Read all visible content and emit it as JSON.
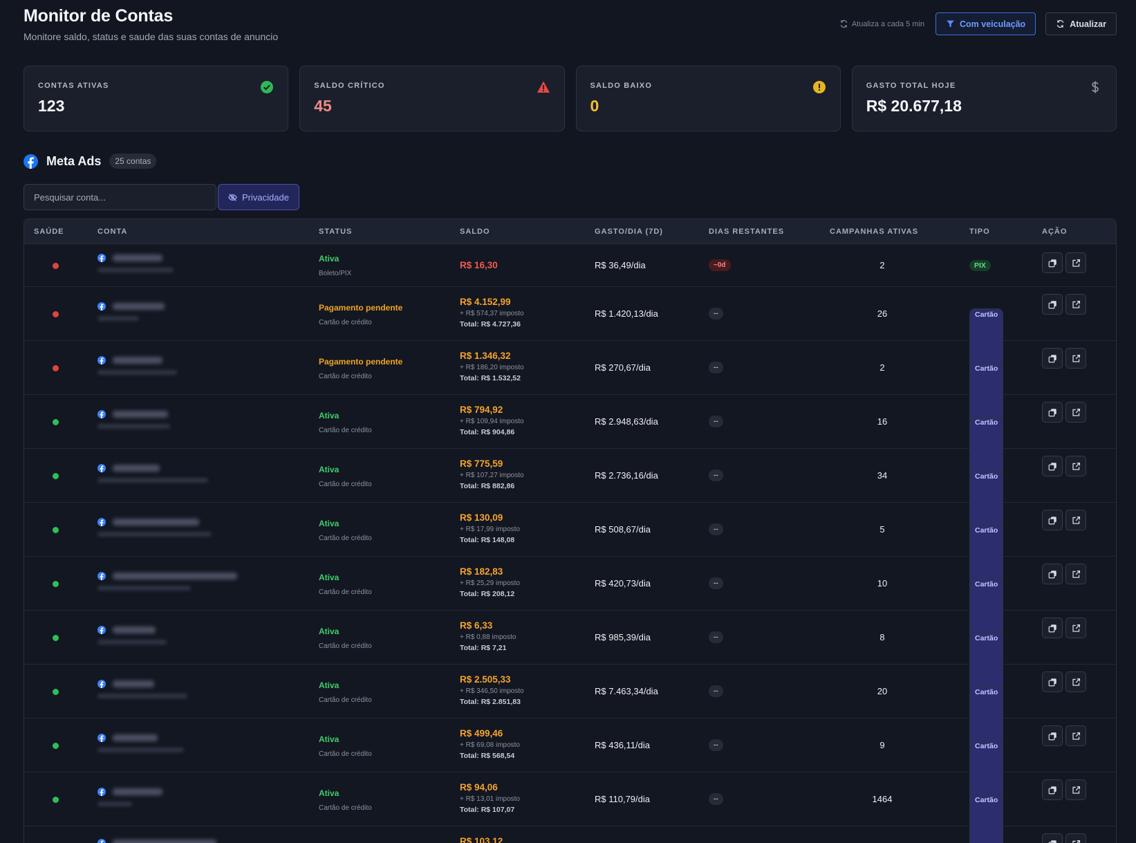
{
  "header": {
    "title": "Monitor de Contas",
    "subtitle": "Monitore saldo, status e saude das suas contas de anuncio",
    "auto_refresh": "Atualiza a cada 5 min",
    "filter_label": "Com veiculação",
    "refresh_label": "Atualizar"
  },
  "cards": [
    {
      "label": "CONTAS ATIVAS",
      "value": "123",
      "color": "#f5f6f9",
      "icon": "check-circle-icon"
    },
    {
      "label": "SALDO CRÍTICO",
      "value": "45",
      "color": "#f08a82",
      "icon": "warning-triangle-icon"
    },
    {
      "label": "SALDO BAIXO",
      "value": "0",
      "color": "#f4c02f",
      "icon": "alert-circle-icon"
    },
    {
      "label": "GASTO TOTAL HOJE",
      "value": "R$ 20.677,18",
      "color": "#f5f6f9",
      "icon": "dollar-icon"
    }
  ],
  "section": {
    "name": "Meta Ads",
    "count": "25 contas",
    "icon": "facebook-icon"
  },
  "search": {
    "placeholder": "Pesquisar conta..."
  },
  "privacy_label": "Privacidade",
  "table": {
    "headers": [
      "SAÚDE",
      "CONTA",
      "STATUS",
      "SALDO",
      "GASTO/DIA (7D)",
      "DIAS RESTANTES",
      "CAMPANHAS ATIVAS",
      "TIPO",
      "AÇÃO"
    ],
    "rows": [
      {
        "health": "red",
        "status": "Ativa",
        "status_color": "#3ecf6b",
        "payment": "Boleto/PIX",
        "saldo": "R$ 16,30",
        "saldo_color": "#f05a4f",
        "tax": "",
        "total": "",
        "gasto": "R$ 36,49/dia",
        "days": "~0d",
        "days_kind": "danger",
        "campaigns": "2",
        "tipo": "PIX",
        "tipo_kind": "pix"
      },
      {
        "health": "red",
        "status": "Pagamento pendente",
        "status_color": "#f0a424",
        "payment": "Cartão de crédito",
        "saldo": "R$ 4.152,99",
        "saldo_color": "#f5a331",
        "tax": "+ R$ 574,37 imposto",
        "total": "Total: R$ 4.727,36",
        "gasto": "R$ 1.420,13/dia",
        "days": "--",
        "days_kind": "neutral",
        "campaigns": "26",
        "tipo": "Cartão",
        "tipo_kind": "card"
      },
      {
        "health": "red",
        "status": "Pagamento pendente",
        "status_color": "#f0a424",
        "payment": "Cartão de crédito",
        "saldo": "R$ 1.346,32",
        "saldo_color": "#f5a331",
        "tax": "+ R$ 186,20 imposto",
        "total": "Total: R$ 1.532,52",
        "gasto": "R$ 270,67/dia",
        "days": "--",
        "days_kind": "neutral",
        "campaigns": "2",
        "tipo": "Cartão",
        "tipo_kind": "card"
      },
      {
        "health": "green",
        "status": "Ativa",
        "status_color": "#3ecf6b",
        "payment": "Cartão de crédito",
        "saldo": "R$ 794,92",
        "saldo_color": "#f5a331",
        "tax": "+ R$ 109,94 imposto",
        "total": "Total: R$ 904,86",
        "gasto": "R$ 2.948,63/dia",
        "days": "--",
        "days_kind": "neutral",
        "campaigns": "16",
        "tipo": "Cartão",
        "tipo_kind": "card"
      },
      {
        "health": "green",
        "status": "Ativa",
        "status_color": "#3ecf6b",
        "payment": "Cartão de crédito",
        "saldo": "R$ 775,59",
        "saldo_color": "#f5a331",
        "tax": "+ R$ 107,27 imposto",
        "total": "Total: R$ 882,86",
        "gasto": "R$ 2.736,16/dia",
        "days": "--",
        "days_kind": "neutral",
        "campaigns": "34",
        "tipo": "Cartão",
        "tipo_kind": "card"
      },
      {
        "health": "green",
        "status": "Ativa",
        "status_color": "#3ecf6b",
        "payment": "Cartão de crédito",
        "saldo": "R$ 130,09",
        "saldo_color": "#f5a331",
        "tax": "+ R$ 17,99 imposto",
        "total": "Total: R$ 148,08",
        "gasto": "R$ 508,67/dia",
        "days": "--",
        "days_kind": "neutral",
        "campaigns": "5",
        "tipo": "Cartão",
        "tipo_kind": "card"
      },
      {
        "health": "green",
        "status": "Ativa",
        "status_color": "#3ecf6b",
        "payment": "Cartão de crédito",
        "saldo": "R$ 182,83",
        "saldo_color": "#f5a331",
        "tax": "+ R$ 25,29 imposto",
        "total": "Total: R$ 208,12",
        "gasto": "R$ 420,73/dia",
        "days": "--",
        "days_kind": "neutral",
        "campaigns": "10",
        "tipo": "Cartão",
        "tipo_kind": "card"
      },
      {
        "health": "green",
        "status": "Ativa",
        "status_color": "#3ecf6b",
        "payment": "Cartão de crédito",
        "saldo": "R$ 6,33",
        "saldo_color": "#f5a331",
        "tax": "+ R$ 0,88 imposto",
        "total": "Total: R$ 7,21",
        "gasto": "R$ 985,39/dia",
        "days": "--",
        "days_kind": "neutral",
        "campaigns": "8",
        "tipo": "Cartão",
        "tipo_kind": "card"
      },
      {
        "health": "green",
        "status": "Ativa",
        "status_color": "#3ecf6b",
        "payment": "Cartão de crédito",
        "saldo": "R$ 2.505,33",
        "saldo_color": "#f5a331",
        "tax": "+ R$ 346,50 imposto",
        "total": "Total: R$ 2.851,83",
        "gasto": "R$ 7.463,34/dia",
        "days": "--",
        "days_kind": "neutral",
        "campaigns": "20",
        "tipo": "Cartão",
        "tipo_kind": "card"
      },
      {
        "health": "green",
        "status": "Ativa",
        "status_color": "#3ecf6b",
        "payment": "Cartão de crédito",
        "saldo": "R$ 499,46",
        "saldo_color": "#f5a331",
        "tax": "+ R$ 69,08 imposto",
        "total": "Total: R$ 568,54",
        "gasto": "R$ 436,11/dia",
        "days": "--",
        "days_kind": "neutral",
        "campaigns": "9",
        "tipo": "Cartão",
        "tipo_kind": "card"
      },
      {
        "health": "green",
        "status": "Ativa",
        "status_color": "#3ecf6b",
        "payment": "Cartão de crédito",
        "saldo": "R$ 94,06",
        "saldo_color": "#f5a331",
        "tax": "+ R$ 13,01 imposto",
        "total": "Total: R$ 107,07",
        "gasto": "R$ 110,79/dia",
        "days": "--",
        "days_kind": "neutral",
        "campaigns": "1464",
        "tipo": "Cartão",
        "tipo_kind": "card"
      },
      {
        "health": "green",
        "status": "",
        "status_color": "#3ecf6b",
        "payment": "",
        "saldo": "R$ 103,12",
        "saldo_color": "#f5a331",
        "tax": "",
        "total": "",
        "gasto": "",
        "days": "",
        "days_kind": "neutral",
        "campaigns": "",
        "tipo": "",
        "tipo_kind": "card"
      }
    ]
  }
}
